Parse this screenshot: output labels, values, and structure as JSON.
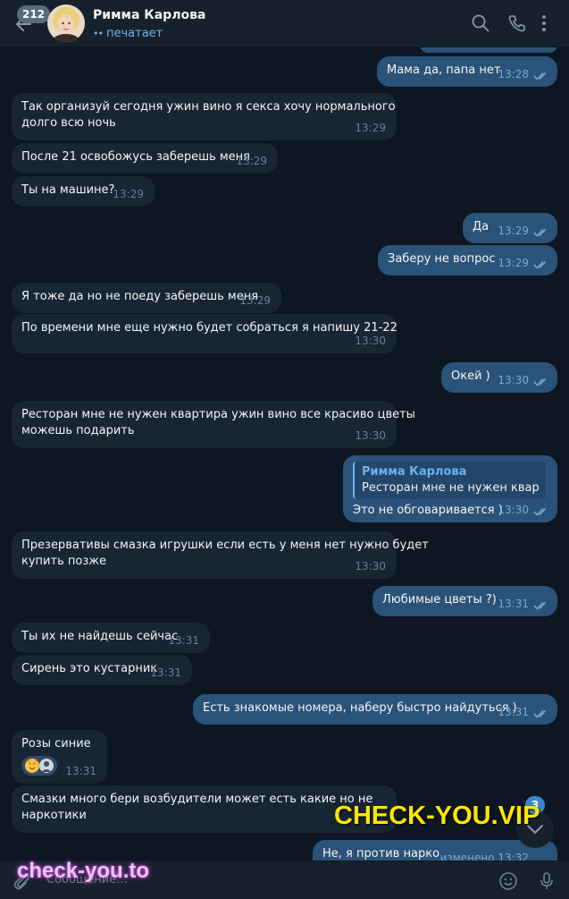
{
  "header": {
    "unread_count": "212",
    "contact_name": "Римма Карлова",
    "status": "печатает",
    "typing_dots": "••"
  },
  "messages": [
    {
      "dir": "out",
      "text": "Мама да, папа нет",
      "time": "13:28"
    },
    {
      "dir": "in",
      "lines": [
        "Так организуй сегодня ужин вино я секса хочу нормального",
        "долго всю ночь"
      ],
      "time": "13:29"
    },
    {
      "dir": "in",
      "text": "После 21 освобожусь заберешь меня",
      "time": "13:29"
    },
    {
      "dir": "in",
      "text": "Ты на машине?",
      "time": "13:29"
    },
    {
      "dir": "out",
      "text": "Да",
      "time": "13:29"
    },
    {
      "dir": "out",
      "text": "Заберу не вопрос",
      "time": "13:29"
    },
    {
      "dir": "in",
      "text": "Я тоже да но не поеду заберешь меня",
      "time": "13:29"
    },
    {
      "dir": "in",
      "text": "По времени мне еще нужно будет собраться я напишу 21-22",
      "time": "13:30"
    },
    {
      "dir": "out",
      "text": "Окей )",
      "time": "13:30"
    },
    {
      "dir": "in",
      "lines": [
        "Ресторан мне не нужен квартира ужин вино все красиво цветы",
        "можешь подарить"
      ],
      "time": "13:30"
    },
    {
      "dir": "out",
      "reply_name": "Римма Карлова",
      "reply_text": "Ресторан мне не нужен кварт...",
      "text": "Это не обговаривается )",
      "time": "13:30"
    },
    {
      "dir": "in",
      "lines": [
        "Презервативы смазка игрушки если есть у меня нет нужно будет",
        "купить позже"
      ],
      "time": "13:30"
    },
    {
      "dir": "out",
      "text": "Любимые цветы ?)",
      "time": "13:31"
    },
    {
      "dir": "in",
      "text": "Ты их не найдешь сейчас",
      "time": "13:31"
    },
    {
      "dir": "in",
      "text": "Сирень это кустарник",
      "time": "13:31"
    },
    {
      "dir": "out",
      "text": "Есть знакомые номера, наберу быстро найдуться )",
      "time": "13:31"
    },
    {
      "dir": "in",
      "text": "Розы синие",
      "time": "13:31"
    },
    {
      "dir": "in",
      "lines": [
        "Смазки много бери возбудители может есть какие но не",
        "наркотики"
      ],
      "time": "13:32"
    },
    {
      "dir": "out",
      "text": "Не, я против нарко",
      "time": "изменено 13:32"
    }
  ],
  "scroll": {
    "new_count": "3"
  },
  "composer": {
    "placeholder": "Сообщение..."
  },
  "watermarks": {
    "top": "CHECK-YOU.VIP",
    "bottom": "check-you.to"
  },
  "colors": {
    "bg": "#0e1621",
    "incoming": "#182533",
    "outgoing": "#2b5278",
    "accent": "#6ab2f2"
  }
}
